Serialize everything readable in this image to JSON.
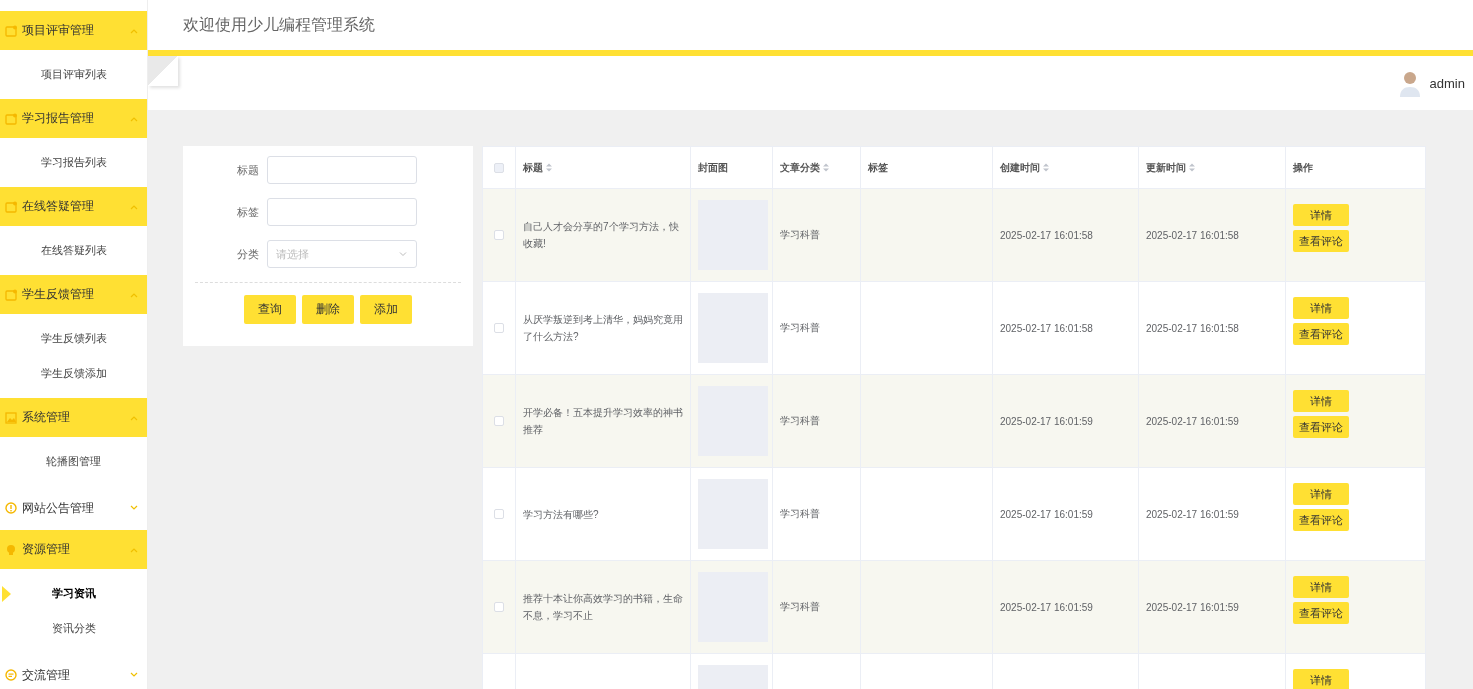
{
  "header": {
    "title": "欢迎使用少儿编程管理系统",
    "user": "admin"
  },
  "sidebar": {
    "groups": [
      {
        "label": "项目评审管理",
        "expanded": true,
        "children": [
          {
            "label": "项目评审列表",
            "selected": false
          }
        ]
      },
      {
        "label": "学习报告管理",
        "expanded": true,
        "children": [
          {
            "label": "学习报告列表",
            "selected": false
          }
        ]
      },
      {
        "label": "在线答疑管理",
        "expanded": true,
        "children": [
          {
            "label": "在线答疑列表",
            "selected": false
          }
        ]
      },
      {
        "label": "学生反馈管理",
        "expanded": true,
        "children": [
          {
            "label": "学生反馈列表",
            "selected": false
          },
          {
            "label": "学生反馈添加",
            "selected": false
          }
        ]
      },
      {
        "label": "系统管理",
        "expanded": true,
        "children": [
          {
            "label": "轮播图管理",
            "selected": false
          }
        ]
      },
      {
        "label": "网站公告管理",
        "expanded": false
      },
      {
        "label": "资源管理",
        "expanded": true,
        "children": [
          {
            "label": "学习资讯",
            "selected": true
          },
          {
            "label": "资讯分类",
            "selected": false
          }
        ]
      },
      {
        "label": "交流管理",
        "expanded": false
      }
    ]
  },
  "search": {
    "fields": [
      {
        "label": "标题",
        "kind": "input"
      },
      {
        "label": "标签",
        "kind": "input"
      },
      {
        "label": "分类",
        "kind": "select",
        "placeholder": "请选择"
      }
    ],
    "buttons": [
      "查询",
      "删除",
      "添加"
    ]
  },
  "table": {
    "select_all_checked": false,
    "columns": [
      {
        "label": "标题",
        "sortable": true
      },
      {
        "label": "封面图",
        "sortable": false
      },
      {
        "label": "文章分类",
        "sortable": true
      },
      {
        "label": "标签",
        "sortable": false
      },
      {
        "label": "创建时间",
        "sortable": true
      },
      {
        "label": "更新时间",
        "sortable": true
      },
      {
        "label": "操作",
        "sortable": false
      }
    ],
    "rows": [
      {
        "checked": false,
        "title": "自己人才会分享的7个学习方法，快收藏!",
        "category": "学习科普",
        "created": "2025-02-17 16:01:58",
        "updated": "2025-02-17 16:01:58",
        "actions": [
          "详情",
          "查看评论"
        ]
      },
      {
        "checked": false,
        "title": "从厌学叛逆到考上清华，妈妈究竟用了什么方法?",
        "category": "学习科普",
        "created": "2025-02-17 16:01:58",
        "updated": "2025-02-17 16:01:58",
        "actions": [
          "详情",
          "查看评论"
        ]
      },
      {
        "checked": false,
        "title": "开学必备！五本提升学习效率的神书推荐",
        "category": "学习科普",
        "created": "2025-02-17 16:01:59",
        "updated": "2025-02-17 16:01:59",
        "actions": [
          "详情",
          "查看评论"
        ]
      },
      {
        "checked": false,
        "title": "学习方法有哪些?",
        "category": "学习科普",
        "created": "2025-02-17 16:01:59",
        "updated": "2025-02-17 16:01:59",
        "actions": [
          "详情",
          "查看评论"
        ]
      },
      {
        "checked": false,
        "title": "推荐十本让你高效学习的书籍，生命不息，学习不止",
        "category": "学习科普",
        "created": "2025-02-17 16:01:59",
        "updated": "2025-02-17 16:01:59",
        "actions": [
          "详情",
          "查看评论"
        ]
      },
      {
        "actions": [
          "详情"
        ]
      }
    ]
  }
}
